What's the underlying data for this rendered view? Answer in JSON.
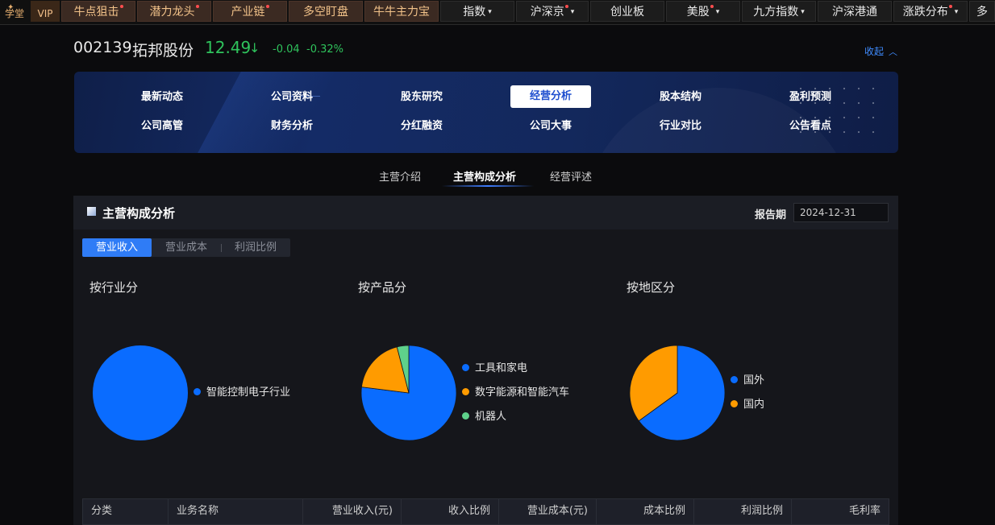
{
  "topnav": {
    "xuetang": "学堂",
    "vip": "VIP",
    "items": [
      {
        "label": "牛点狙击",
        "dot": true
      },
      {
        "label": "潜力龙头",
        "dot": true
      },
      {
        "label": "产业链",
        "dot": true
      },
      {
        "label": "多空盯盘",
        "dot": false
      },
      {
        "label": "牛牛主力宝",
        "dot": false
      },
      {
        "label": "指数",
        "caret": true
      },
      {
        "label": "沪深京",
        "dot": true,
        "caret": true
      },
      {
        "label": "创业板"
      },
      {
        "label": "美股",
        "dot": true,
        "caret": true
      },
      {
        "label": "九方指数",
        "caret": true
      },
      {
        "label": "沪深港通"
      },
      {
        "label": "涨跌分布",
        "dot": true,
        "caret": true
      },
      {
        "label": "多"
      }
    ],
    "caret_glyph": "▾"
  },
  "stock": {
    "code": "002139",
    "name": "拓邦股份",
    "price": "12.49",
    "arrow": "↓",
    "change": "-0.04",
    "change_pct": "-0.32%",
    "collapse_label": "收起",
    "collapse_icon": "︿"
  },
  "menu": {
    "row1": [
      "最新动态",
      "公司资料",
      "股东研究",
      "经营分析",
      "股本结构",
      "盈利预测"
    ],
    "row2": [
      "公司高管",
      "财务分析",
      "分红融资",
      "公司大事",
      "行业对比",
      "公告看点"
    ],
    "active": "经营分析"
  },
  "subtabs": [
    "主营介绍",
    "主营构成分析",
    "经营评述"
  ],
  "subtab_active": "主营构成分析",
  "card": {
    "title": "主营构成分析",
    "period_label": "报告期",
    "period_value": "2024-12-31"
  },
  "segments": [
    "营业收入",
    "营业成本",
    "利润比例"
  ],
  "segment_active": "营业收入",
  "colors": {
    "blue": "#0a6cff",
    "orange": "#ff9b00",
    "green": "#5ed18b",
    "accent": "#2f7cf6",
    "up_down_green": "#2fc35c"
  },
  "chart_data": [
    {
      "type": "pie",
      "title": "按行业分",
      "labels": [
        "智能控制电子行业"
      ],
      "values": [
        100
      ],
      "colors": [
        "#0a6cff"
      ]
    },
    {
      "type": "pie",
      "title": "按产品分",
      "labels": [
        "工具和家电",
        "数字能源和智能汽车",
        "机器人"
      ],
      "values": [
        77,
        19,
        4
      ],
      "colors": [
        "#0a6cff",
        "#ff9b00",
        "#5ed18b"
      ]
    },
    {
      "type": "pie",
      "title": "按地区分",
      "labels": [
        "国外",
        "国内"
      ],
      "values": [
        65,
        35
      ],
      "colors": [
        "#0a6cff",
        "#ff9b00"
      ]
    }
  ],
  "table": {
    "headers": [
      "分类",
      "业务名称",
      "营业收入(元)",
      "收入比例",
      "营业成本(元)",
      "成本比例",
      "利润比例",
      "毛利率"
    ]
  }
}
